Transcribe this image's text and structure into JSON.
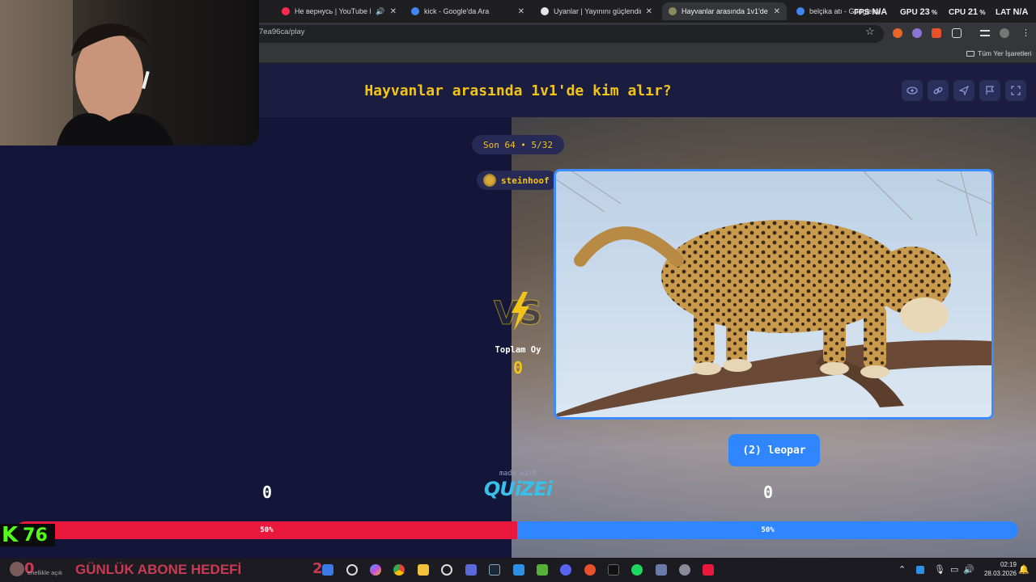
{
  "browser": {
    "tabs": [
      {
        "title": "Не вернусь | YouTube Mu",
        "favicon_color": "#ff2b4e",
        "muted_icon": "speaker-icon"
      },
      {
        "title": "kick - Google'da Ara",
        "favicon_color": "#4285f4"
      },
      {
        "title": "Uyanlar | Yayınını güçlendirmek",
        "favicon_color": "#e6e6e6"
      },
      {
        "title": "Hayvanlar arasında 1v1'de kim",
        "favicon_color": "#8a8a5a",
        "active": true
      },
      {
        "title": "belçika atı - Google'da Ara",
        "favicon_color": "#4285f4"
      }
    ],
    "url": "7ea96ca/play",
    "bookmarks_label": "Tüm Yer İşaretleri"
  },
  "perf_overlay": {
    "fps_label": "FPS",
    "fps_value": "N/A",
    "gpu_label": "GPU",
    "gpu_value": "23",
    "cpu_label": "CPU",
    "cpu_value": "21",
    "lat_label": "LAT",
    "lat_value": "N/A"
  },
  "page": {
    "title": "Hayvanlar arasında 1v1'de kim alır?",
    "header_buttons": [
      "eye-icon",
      "link-icon",
      "send-icon",
      "flag-icon",
      "fullscreen-icon"
    ],
    "round": "Son 64 • 5/32",
    "creator": "steinhoof",
    "vs_label": "VS",
    "total_votes_label": "Toplam Oy",
    "total_votes_value": "0",
    "right_choice_label": "(2) leopar",
    "made_with": "made with",
    "brand": "QUiZEi",
    "left_score": "0",
    "right_score": "0",
    "left_percent_label": "50%",
    "right_percent_label": "50%",
    "left_share": 0.5,
    "colors": {
      "accent": "#f2c418",
      "left": "#e8193c",
      "right": "#2f86ff",
      "background": "#131638"
    }
  },
  "stream_overlay": {
    "kick_logo": "K",
    "viewer_count": "76",
    "goal_count": "0",
    "goal_text": "GÜNLÜK ABONE HEDEFİ",
    "goal_target": "2",
    "small_note": "enellikle açık"
  },
  "taskbar": {
    "time": "02:19",
    "date": "28.03.2026"
  }
}
